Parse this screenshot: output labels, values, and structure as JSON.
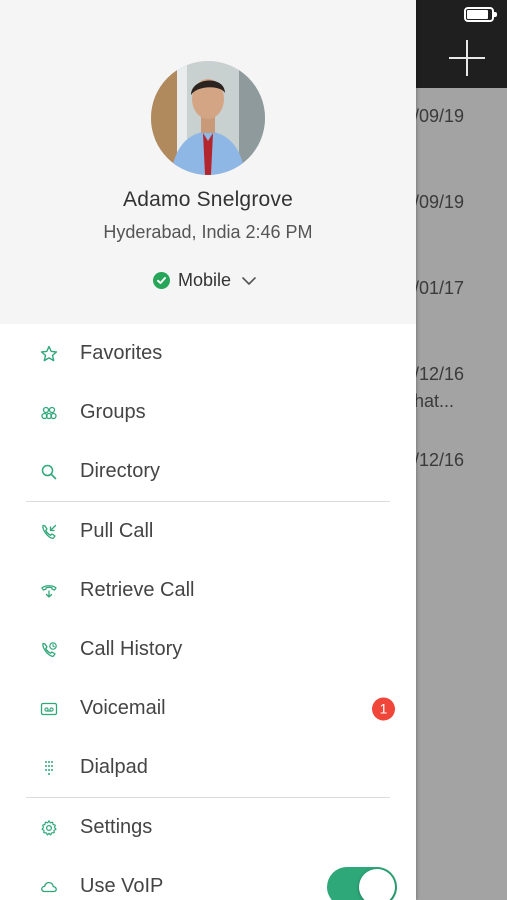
{
  "background": {
    "dates": [
      "/09/19",
      "/09/19",
      "/01/17",
      "/12/16",
      "hat...",
      "/12/16"
    ]
  },
  "profile": {
    "name": "Adamo Snelgrove",
    "location": "Hyderabad, India 2:46 PM",
    "status_label": "Mobile",
    "status_color": "#27a65a"
  },
  "menu": {
    "favorites": "Favorites",
    "groups": "Groups",
    "directory": "Directory",
    "pull_call": "Pull Call",
    "retrieve_call": "Retrieve Call",
    "call_history": "Call History",
    "voicemail": "Voicemail",
    "voicemail_badge": "1",
    "dialpad": "Dialpad",
    "settings": "Settings",
    "use_voip": "Use VoIP"
  },
  "colors": {
    "accent": "#2ea779",
    "badge": "#f0463a"
  }
}
